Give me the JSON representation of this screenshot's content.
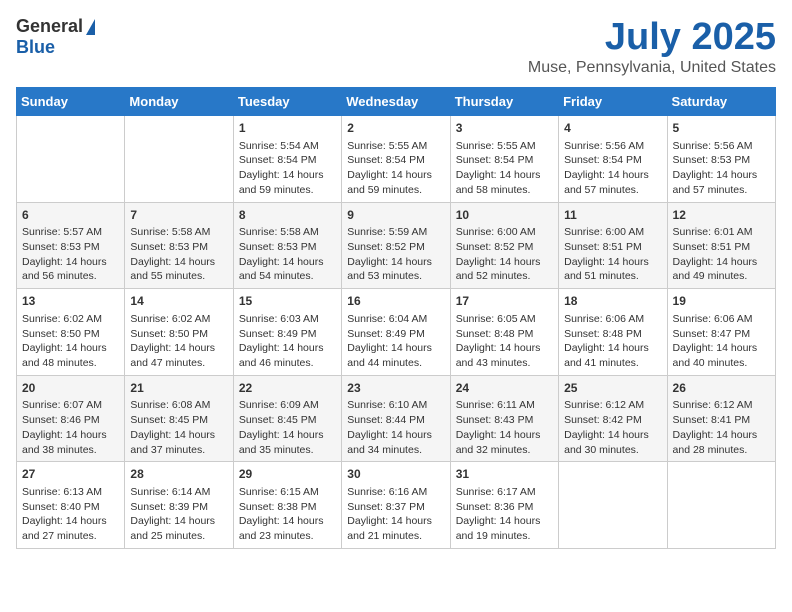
{
  "header": {
    "logo_general": "General",
    "logo_blue": "Blue",
    "month": "July 2025",
    "location": "Muse, Pennsylvania, United States"
  },
  "days_of_week": [
    "Sunday",
    "Monday",
    "Tuesday",
    "Wednesday",
    "Thursday",
    "Friday",
    "Saturday"
  ],
  "weeks": [
    [
      {
        "day": "",
        "sunrise": "",
        "sunset": "",
        "daylight": ""
      },
      {
        "day": "",
        "sunrise": "",
        "sunset": "",
        "daylight": ""
      },
      {
        "day": "1",
        "sunrise": "Sunrise: 5:54 AM",
        "sunset": "Sunset: 8:54 PM",
        "daylight": "Daylight: 14 hours and 59 minutes."
      },
      {
        "day": "2",
        "sunrise": "Sunrise: 5:55 AM",
        "sunset": "Sunset: 8:54 PM",
        "daylight": "Daylight: 14 hours and 59 minutes."
      },
      {
        "day": "3",
        "sunrise": "Sunrise: 5:55 AM",
        "sunset": "Sunset: 8:54 PM",
        "daylight": "Daylight: 14 hours and 58 minutes."
      },
      {
        "day": "4",
        "sunrise": "Sunrise: 5:56 AM",
        "sunset": "Sunset: 8:54 PM",
        "daylight": "Daylight: 14 hours and 57 minutes."
      },
      {
        "day": "5",
        "sunrise": "Sunrise: 5:56 AM",
        "sunset": "Sunset: 8:53 PM",
        "daylight": "Daylight: 14 hours and 57 minutes."
      }
    ],
    [
      {
        "day": "6",
        "sunrise": "Sunrise: 5:57 AM",
        "sunset": "Sunset: 8:53 PM",
        "daylight": "Daylight: 14 hours and 56 minutes."
      },
      {
        "day": "7",
        "sunrise": "Sunrise: 5:58 AM",
        "sunset": "Sunset: 8:53 PM",
        "daylight": "Daylight: 14 hours and 55 minutes."
      },
      {
        "day": "8",
        "sunrise": "Sunrise: 5:58 AM",
        "sunset": "Sunset: 8:53 PM",
        "daylight": "Daylight: 14 hours and 54 minutes."
      },
      {
        "day": "9",
        "sunrise": "Sunrise: 5:59 AM",
        "sunset": "Sunset: 8:52 PM",
        "daylight": "Daylight: 14 hours and 53 minutes."
      },
      {
        "day": "10",
        "sunrise": "Sunrise: 6:00 AM",
        "sunset": "Sunset: 8:52 PM",
        "daylight": "Daylight: 14 hours and 52 minutes."
      },
      {
        "day": "11",
        "sunrise": "Sunrise: 6:00 AM",
        "sunset": "Sunset: 8:51 PM",
        "daylight": "Daylight: 14 hours and 51 minutes."
      },
      {
        "day": "12",
        "sunrise": "Sunrise: 6:01 AM",
        "sunset": "Sunset: 8:51 PM",
        "daylight": "Daylight: 14 hours and 49 minutes."
      }
    ],
    [
      {
        "day": "13",
        "sunrise": "Sunrise: 6:02 AM",
        "sunset": "Sunset: 8:50 PM",
        "daylight": "Daylight: 14 hours and 48 minutes."
      },
      {
        "day": "14",
        "sunrise": "Sunrise: 6:02 AM",
        "sunset": "Sunset: 8:50 PM",
        "daylight": "Daylight: 14 hours and 47 minutes."
      },
      {
        "day": "15",
        "sunrise": "Sunrise: 6:03 AM",
        "sunset": "Sunset: 8:49 PM",
        "daylight": "Daylight: 14 hours and 46 minutes."
      },
      {
        "day": "16",
        "sunrise": "Sunrise: 6:04 AM",
        "sunset": "Sunset: 8:49 PM",
        "daylight": "Daylight: 14 hours and 44 minutes."
      },
      {
        "day": "17",
        "sunrise": "Sunrise: 6:05 AM",
        "sunset": "Sunset: 8:48 PM",
        "daylight": "Daylight: 14 hours and 43 minutes."
      },
      {
        "day": "18",
        "sunrise": "Sunrise: 6:06 AM",
        "sunset": "Sunset: 8:48 PM",
        "daylight": "Daylight: 14 hours and 41 minutes."
      },
      {
        "day": "19",
        "sunrise": "Sunrise: 6:06 AM",
        "sunset": "Sunset: 8:47 PM",
        "daylight": "Daylight: 14 hours and 40 minutes."
      }
    ],
    [
      {
        "day": "20",
        "sunrise": "Sunrise: 6:07 AM",
        "sunset": "Sunset: 8:46 PM",
        "daylight": "Daylight: 14 hours and 38 minutes."
      },
      {
        "day": "21",
        "sunrise": "Sunrise: 6:08 AM",
        "sunset": "Sunset: 8:45 PM",
        "daylight": "Daylight: 14 hours and 37 minutes."
      },
      {
        "day": "22",
        "sunrise": "Sunrise: 6:09 AM",
        "sunset": "Sunset: 8:45 PM",
        "daylight": "Daylight: 14 hours and 35 minutes."
      },
      {
        "day": "23",
        "sunrise": "Sunrise: 6:10 AM",
        "sunset": "Sunset: 8:44 PM",
        "daylight": "Daylight: 14 hours and 34 minutes."
      },
      {
        "day": "24",
        "sunrise": "Sunrise: 6:11 AM",
        "sunset": "Sunset: 8:43 PM",
        "daylight": "Daylight: 14 hours and 32 minutes."
      },
      {
        "day": "25",
        "sunrise": "Sunrise: 6:12 AM",
        "sunset": "Sunset: 8:42 PM",
        "daylight": "Daylight: 14 hours and 30 minutes."
      },
      {
        "day": "26",
        "sunrise": "Sunrise: 6:12 AM",
        "sunset": "Sunset: 8:41 PM",
        "daylight": "Daylight: 14 hours and 28 minutes."
      }
    ],
    [
      {
        "day": "27",
        "sunrise": "Sunrise: 6:13 AM",
        "sunset": "Sunset: 8:40 PM",
        "daylight": "Daylight: 14 hours and 27 minutes."
      },
      {
        "day": "28",
        "sunrise": "Sunrise: 6:14 AM",
        "sunset": "Sunset: 8:39 PM",
        "daylight": "Daylight: 14 hours and 25 minutes."
      },
      {
        "day": "29",
        "sunrise": "Sunrise: 6:15 AM",
        "sunset": "Sunset: 8:38 PM",
        "daylight": "Daylight: 14 hours and 23 minutes."
      },
      {
        "day": "30",
        "sunrise": "Sunrise: 6:16 AM",
        "sunset": "Sunset: 8:37 PM",
        "daylight": "Daylight: 14 hours and 21 minutes."
      },
      {
        "day": "31",
        "sunrise": "Sunrise: 6:17 AM",
        "sunset": "Sunset: 8:36 PM",
        "daylight": "Daylight: 14 hours and 19 minutes."
      },
      {
        "day": "",
        "sunrise": "",
        "sunset": "",
        "daylight": ""
      },
      {
        "day": "",
        "sunrise": "",
        "sunset": "",
        "daylight": ""
      }
    ]
  ]
}
